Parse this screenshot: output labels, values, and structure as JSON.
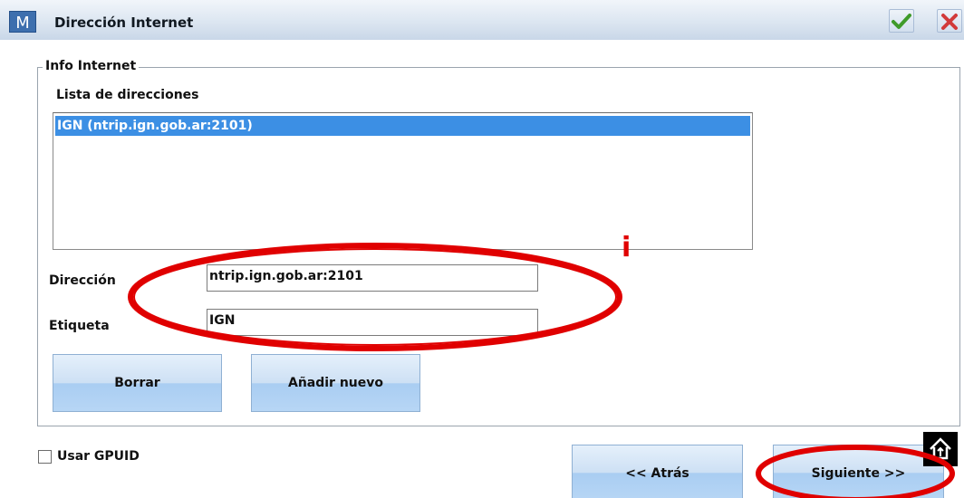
{
  "window": {
    "title": "Dirección Internet",
    "logo_letter": "M",
    "icons": {
      "logo": "app-logo-icon",
      "ok": "checkmark-icon",
      "close": "close-x-icon"
    },
    "colors": {
      "ok": "#3f9b2a",
      "close": "#d23a3a",
      "selection": "#3c8fe4"
    }
  },
  "group": {
    "legend": "Info Internet",
    "list_label": "Lista de direcciones",
    "addresses": [
      "IGN (ntrip.ign.gob.ar:2101)"
    ],
    "direccion_label": "Dirección",
    "direccion_value": "ntrip.ign.gob.ar:2101",
    "etiqueta_label": "Etiqueta",
    "etiqueta_value": "IGN",
    "delete_button": "Borrar",
    "add_button": "Añadir nuevo"
  },
  "footer": {
    "gpuid_label": "Usar GPUID",
    "gpuid_checked": false,
    "back_button": "<< Atrás",
    "next_button": "Siguiente >>"
  },
  "annotation": {
    "mark": "i",
    "color": "#e00000"
  }
}
